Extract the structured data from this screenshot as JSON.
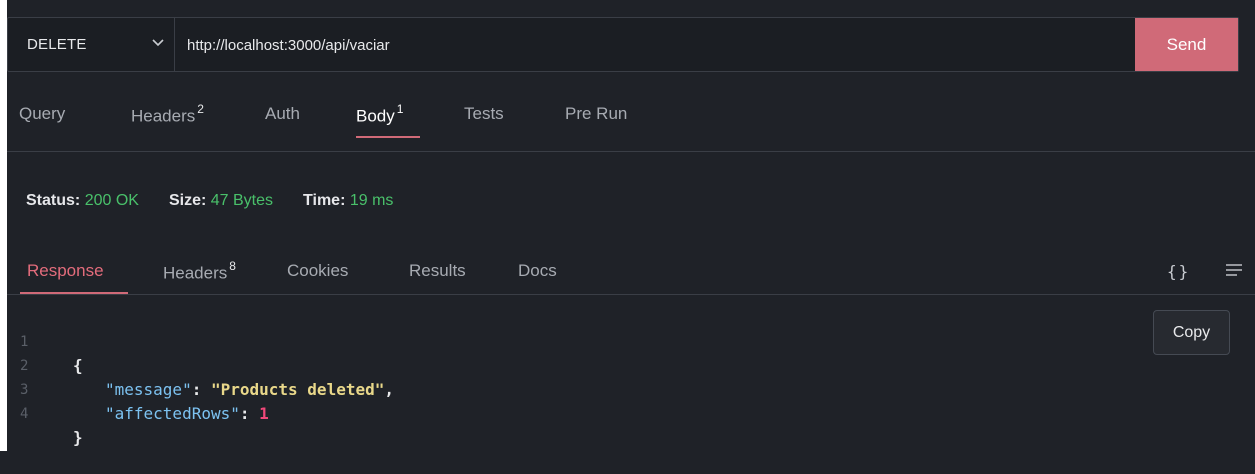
{
  "request": {
    "method": "DELETE",
    "url": "http://localhost:3000/api/vaciar",
    "send_label": "Send"
  },
  "request_tabs": [
    {
      "label": "Query",
      "badge": ""
    },
    {
      "label": "Headers",
      "badge": "2"
    },
    {
      "label": "Auth",
      "badge": ""
    },
    {
      "label": "Body",
      "badge": "1",
      "active": true
    },
    {
      "label": "Tests",
      "badge": ""
    },
    {
      "label": "Pre Run",
      "badge": ""
    }
  ],
  "status": {
    "status_label": "Status:",
    "status_value": "200 OK",
    "size_label": "Size:",
    "size_value": "47 Bytes",
    "time_label": "Time:",
    "time_value": "19 ms"
  },
  "response_tabs": [
    {
      "label": "Response",
      "badge": "",
      "active": true
    },
    {
      "label": "Headers",
      "badge": "8"
    },
    {
      "label": "Cookies",
      "badge": ""
    },
    {
      "label": "Results",
      "badge": ""
    },
    {
      "label": "Docs",
      "badge": ""
    }
  ],
  "toolbar": {
    "braces_icon": "{}",
    "menu_icon": "menu-icon"
  },
  "code_lines": [
    {
      "num": "1",
      "open": "{"
    },
    {
      "num": "2",
      "key": "\"message\"",
      "colon": ": ",
      "value": "\"Products deleted\"",
      "comma": ","
    },
    {
      "num": "3",
      "key": "\"affectedRows\"",
      "colon": ": ",
      "value": "1"
    },
    {
      "num": "4",
      "close": "}"
    }
  ],
  "copy_label": "Copy",
  "colors": {
    "accent": "#d06a78",
    "status_green": "#49c06a",
    "json_key": "#7cc2f1",
    "json_string": "#e9d88a",
    "json_number": "#f0487a"
  }
}
